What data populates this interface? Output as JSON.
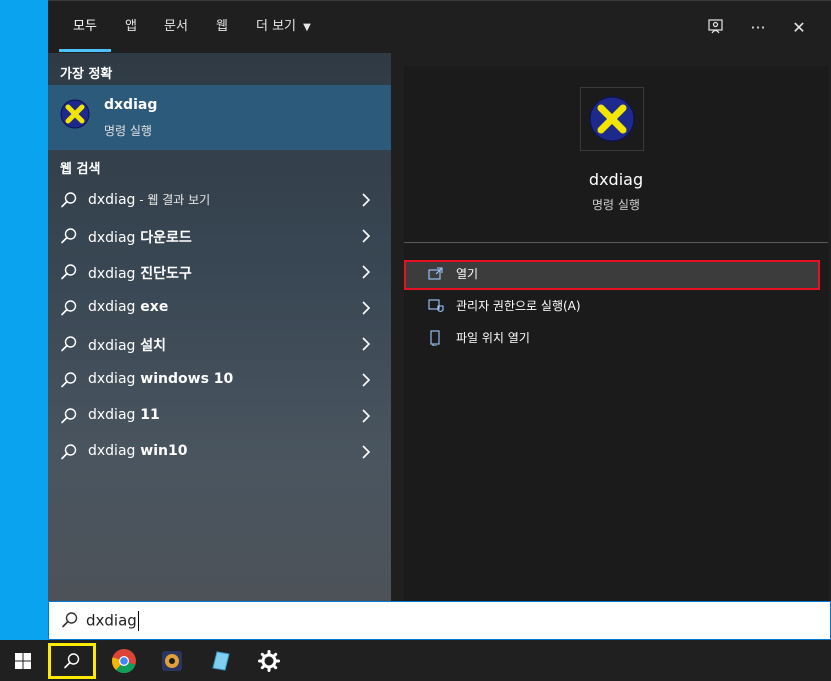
{
  "topbar": {
    "tabs": [
      {
        "label": "모두"
      },
      {
        "label": "앱"
      },
      {
        "label": "문서"
      },
      {
        "label": "웹"
      },
      {
        "label": "더 보기"
      }
    ],
    "feedback_icon": "feedback-icon",
    "more_icon_glyph": "···",
    "close_icon_glyph": "✕"
  },
  "left": {
    "best_title": "가장 정확",
    "best": {
      "name": "dxdiag",
      "sub": "명령 실행"
    },
    "web_title": "웹 검색",
    "web_items": [
      {
        "query": "dxdiag",
        "suffix": " - 웹 결과 보기",
        "suffix_style": "dim"
      },
      {
        "query": "dxdiag",
        "suffix": " 다운로드",
        "suffix_style": "bold"
      },
      {
        "query": "dxdiag",
        "suffix": " 진단도구",
        "suffix_style": "bold"
      },
      {
        "query": "dxdiag",
        "suffix": " exe",
        "suffix_style": "bold"
      },
      {
        "query": "dxdiag",
        "suffix": " 설치",
        "suffix_style": "bold"
      },
      {
        "query": "dxdiag",
        "suffix": " windows 10",
        "suffix_style": "bold"
      },
      {
        "query": "dxdiag",
        "suffix": " 11",
        "suffix_style": "bold"
      },
      {
        "query": "dxdiag",
        "suffix": " win10",
        "suffix_style": "bold"
      }
    ]
  },
  "right": {
    "name": "dxdiag",
    "sub": "명령 실행",
    "actions": [
      {
        "label": "열기",
        "icon": "open-icon"
      },
      {
        "label": "관리자 권한으로 실행(A)",
        "icon": "shield-icon"
      },
      {
        "label": "파일 위치 열기",
        "icon": "file-location-icon"
      }
    ]
  },
  "search": {
    "value": "dxdiag"
  },
  "colors": {
    "accent": "#4cc2ff",
    "selected_border": "#e81123",
    "highlight": "#ffea00",
    "best_bg": "#2c5a7a"
  }
}
